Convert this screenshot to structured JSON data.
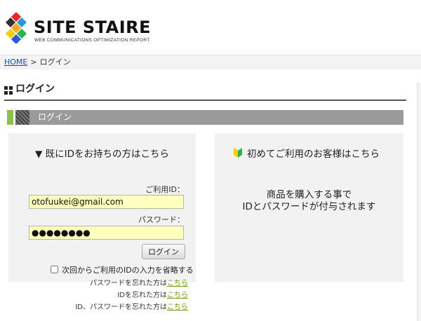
{
  "header": {
    "brand": "SITE STAIRE",
    "tagline": "WEB COMMUNICATIONS OPTIMIZATION REPORT"
  },
  "breadcrumb": {
    "home": "HOME",
    "separator": ">",
    "current": "ログイン"
  },
  "page": {
    "title": "ログイン",
    "section_label": "ログイン"
  },
  "login_panel": {
    "heading": "▼ 既にIDをお持ちの方はこちら",
    "id_label": "ご利用ID：",
    "id_value": "otofuukei@gmail.com",
    "password_label": "パスワード：",
    "password_value": "●●●●●●●●",
    "login_button": "ログイン",
    "remember_label": "次回からご利用のIDの入力を省略する",
    "forgot_password_text": "パスワードを忘れた方は",
    "forgot_id_text": "IDを忘れた方は",
    "forgot_both_text": "ID、パスワードを忘れた方は",
    "link_text": "こちら"
  },
  "new_panel": {
    "heading": "初めてご利用のお客様はこちら",
    "info_line1": "商品を購入する事で",
    "info_line2": "IDとパスワードが付与されます"
  },
  "colors": {
    "accent_green": "#8bc34a",
    "link_blue": "#1a4fa0",
    "link_green": "#6a9a00",
    "input_bg": "#ffffbe",
    "bar_gray": "#9a9a9a"
  }
}
